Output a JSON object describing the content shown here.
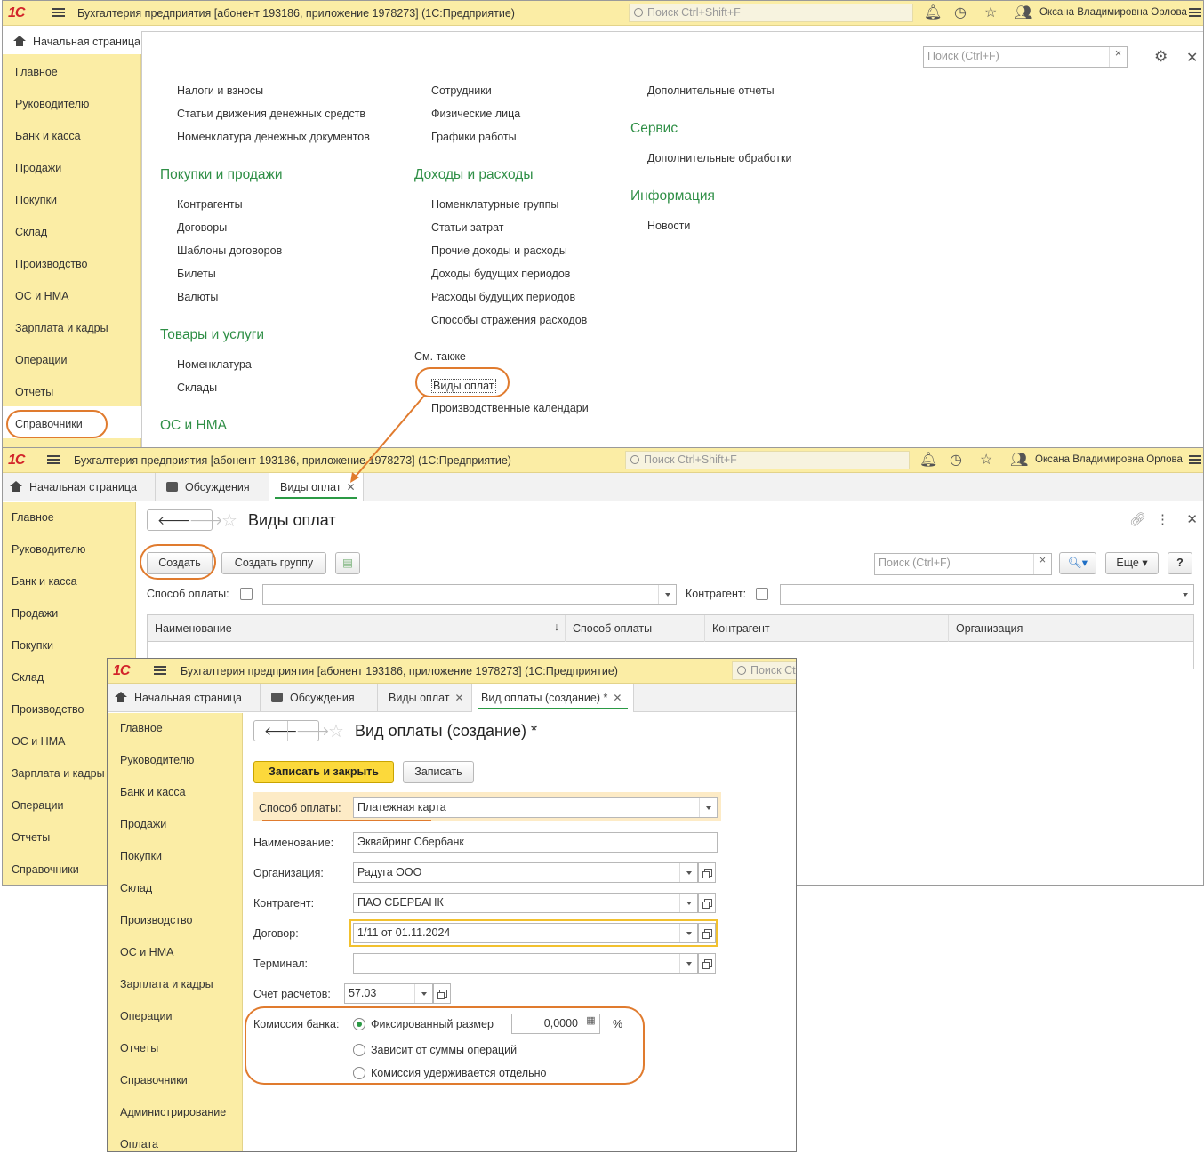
{
  "app": {
    "logo": "1С",
    "title": "Бухгалтерия предприятия [абонент 193186, приложение 1978273]  (1С:Предприятие)",
    "title_short": "Бухгалтерия предприятия [абонент 193186, приложение 1978273]  (1С:Предприятие)",
    "search_placeholder": "Поиск Ctrl+Shift+F",
    "search_placeholder_short": "Поиск Ct",
    "user": "Оксана Владимировна Орлова"
  },
  "sidebar": [
    "Главное",
    "Руководителю",
    "Банк и касса",
    "Продажи",
    "Покупки",
    "Склад",
    "Производство",
    "ОС и НМА",
    "Зарплата и кадры",
    "Операции",
    "Отчеты",
    "Справочники"
  ],
  "sidebar_full": [
    "Главное",
    "Руководителю",
    "Банк и касса",
    "Продажи",
    "Покупки",
    "Склад",
    "Производство",
    "ОС и НМА",
    "Зарплата и кадры",
    "Операции",
    "Отчеты",
    "Справочники",
    "Администрирование",
    "Оплата"
  ],
  "tabs": {
    "home": "Начальная страница",
    "discussions": "Обсуждения",
    "payment_types": "Виды оплат",
    "payment_type_new": "Вид оплаты (создание) *"
  },
  "menu_panel": {
    "search_placeholder": "Поиск (Ctrl+F)",
    "col1_top": [
      "Налоги и взносы",
      "Статьи движения денежных средств",
      "Номенклатура денежных документов"
    ],
    "col1_sections": [
      {
        "title": "Покупки и продажи",
        "items": [
          "Контрагенты",
          "Договоры",
          "Шаблоны договоров",
          "Билеты",
          "Валюты"
        ]
      },
      {
        "title": "Товары и услуги",
        "items": [
          "Номенклатура",
          "Склады"
        ]
      },
      {
        "title": "ОС и НМА",
        "items": []
      }
    ],
    "col2_top": [
      "Сотрудники",
      "Физические лица",
      "Графики работы"
    ],
    "col2_sections": [
      {
        "title": "Доходы и расходы",
        "items": [
          "Номенклатурные группы",
          "Статьи затрат",
          "Прочие доходы и расходы",
          "Доходы будущих периодов",
          "Расходы будущих периодов",
          "Способы отражения расходов"
        ]
      }
    ],
    "see_also": "См. также",
    "see_also_items": [
      "Виды оплат",
      "Производственные календари"
    ],
    "col3_top": [
      "Дополнительные отчеты"
    ],
    "col3_sections": [
      {
        "title": "Сервис",
        "items": [
          "Дополнительные обработки"
        ]
      },
      {
        "title": "Информация",
        "items": [
          "Новости"
        ]
      }
    ]
  },
  "list_form": {
    "title": "Виды оплат",
    "create": "Создать",
    "create_group": "Создать группу",
    "search_placeholder": "Поиск (Ctrl+F)",
    "more": "Еще",
    "help": "?",
    "filter_method_label": "Способ оплаты:",
    "filter_counterparty_label": "Контрагент:",
    "columns": [
      "Наименование",
      "Способ оплаты",
      "Контрагент",
      "Организация"
    ]
  },
  "edit_form": {
    "title": "Вид оплаты (создание) *",
    "save_close": "Записать и закрыть",
    "save": "Записать",
    "method_label": "Способ оплаты:",
    "method_value": "Платежная карта",
    "name_label": "Наименование:",
    "name_value": "Эквайринг Сбербанк",
    "org_label": "Организация:",
    "org_value": "Радуга ООО",
    "counterparty_label": "Контрагент:",
    "counterparty_value": "ПАО СБЕРБАНК",
    "contract_label": "Договор:",
    "contract_value": "1/11 от 01.11.2024",
    "terminal_label": "Терминал:",
    "terminal_value": "",
    "account_label": "Счет расчетов:",
    "account_value": "57.03",
    "fee_label": "Комиссия банка:",
    "fee_options": [
      "Фиксированный размер",
      "Зависит от суммы операций",
      "Комиссия удерживается отдельно"
    ],
    "fee_value": "0,0000",
    "fee_unit": "%"
  },
  "colors": {
    "accent_orange": "#e07b2e",
    "green": "#2f8f46",
    "yellow": "#fbeda5",
    "primary_btn": "#fcd93b"
  }
}
